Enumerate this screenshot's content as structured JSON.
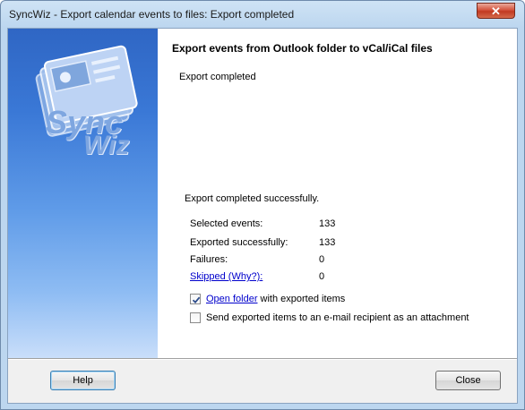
{
  "window": {
    "title": "SyncWiz - Export calendar events to files: Export completed",
    "close_glyph": "✕"
  },
  "sidebar": {
    "logo_line1": "Sync",
    "logo_line2": "Wiz"
  },
  "main": {
    "heading": "Export events from Outlook folder to vCal/iCal files",
    "subheading": "Export completed",
    "success_message": "Export completed successfully.",
    "stats": [
      {
        "label": "Selected events:",
        "value": "133"
      },
      {
        "label": "Exported successfully:",
        "value": "133"
      },
      {
        "label": "Failures:",
        "value": "0"
      },
      {
        "label": "Skipped (Why?):",
        "value": "0"
      }
    ],
    "open_folder": {
      "link": "Open folder",
      "text": " with exported items",
      "checked": true
    },
    "send_email": {
      "text": "Send exported items to an e-mail recipient as an attachment",
      "checked": false
    }
  },
  "buttons": {
    "help": "Help",
    "close": "Close"
  }
}
